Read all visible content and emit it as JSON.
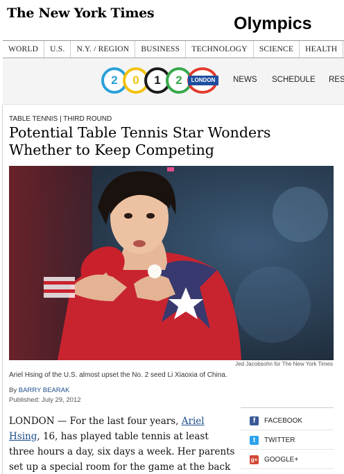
{
  "masthead": {
    "logo": "The New York Times",
    "section": "Olympics"
  },
  "nav": [
    "WORLD",
    "U.S.",
    "N.Y. / REGION",
    "BUSINESS",
    "TECHNOLOGY",
    "SCIENCE",
    "HEALTH"
  ],
  "olympics": {
    "digits": [
      "2",
      "0",
      "1",
      "2"
    ],
    "badge": "LONDON",
    "ring_colors": [
      "#2aa0d8",
      "#f3c20e",
      "#1a1a1a",
      "#36a94b",
      "#e33b2e"
    ],
    "links": [
      "NEWS",
      "SCHEDULE",
      "RES"
    ]
  },
  "article": {
    "kicker": "TABLE TENNIS | THIRD ROUND",
    "headline": "Potential Table Tennis Star Wonders Whether to Keep Competing",
    "photo_credit": "Jed Jacobsohn for The New York Times",
    "caption": "Ariel Hsing of the U.S. almost upset the No. 2 seed Li Xiaoxia of China.",
    "byline_prefix": "By",
    "author": "BARRY BEARAK",
    "published": "Published: July 29, 2012",
    "body_start": "LONDON — For the last four years,",
    "body_link": "Ariel Hsing",
    "body_rest": ", 16, has played table tennis at least three hours a day, six days a week. Her parents set up a special room for the game at the back of their house in"
  },
  "share": [
    {
      "label": "FACEBOOK",
      "icon": "facebook-icon",
      "color": "#3b5998",
      "glyph": "f"
    },
    {
      "label": "TWITTER",
      "icon": "twitter-icon",
      "color": "#2aa3ef",
      "glyph": "t"
    },
    {
      "label": "GOOGLE+",
      "icon": "google-plus-icon",
      "color": "#d34836",
      "glyph": "g+"
    }
  ]
}
